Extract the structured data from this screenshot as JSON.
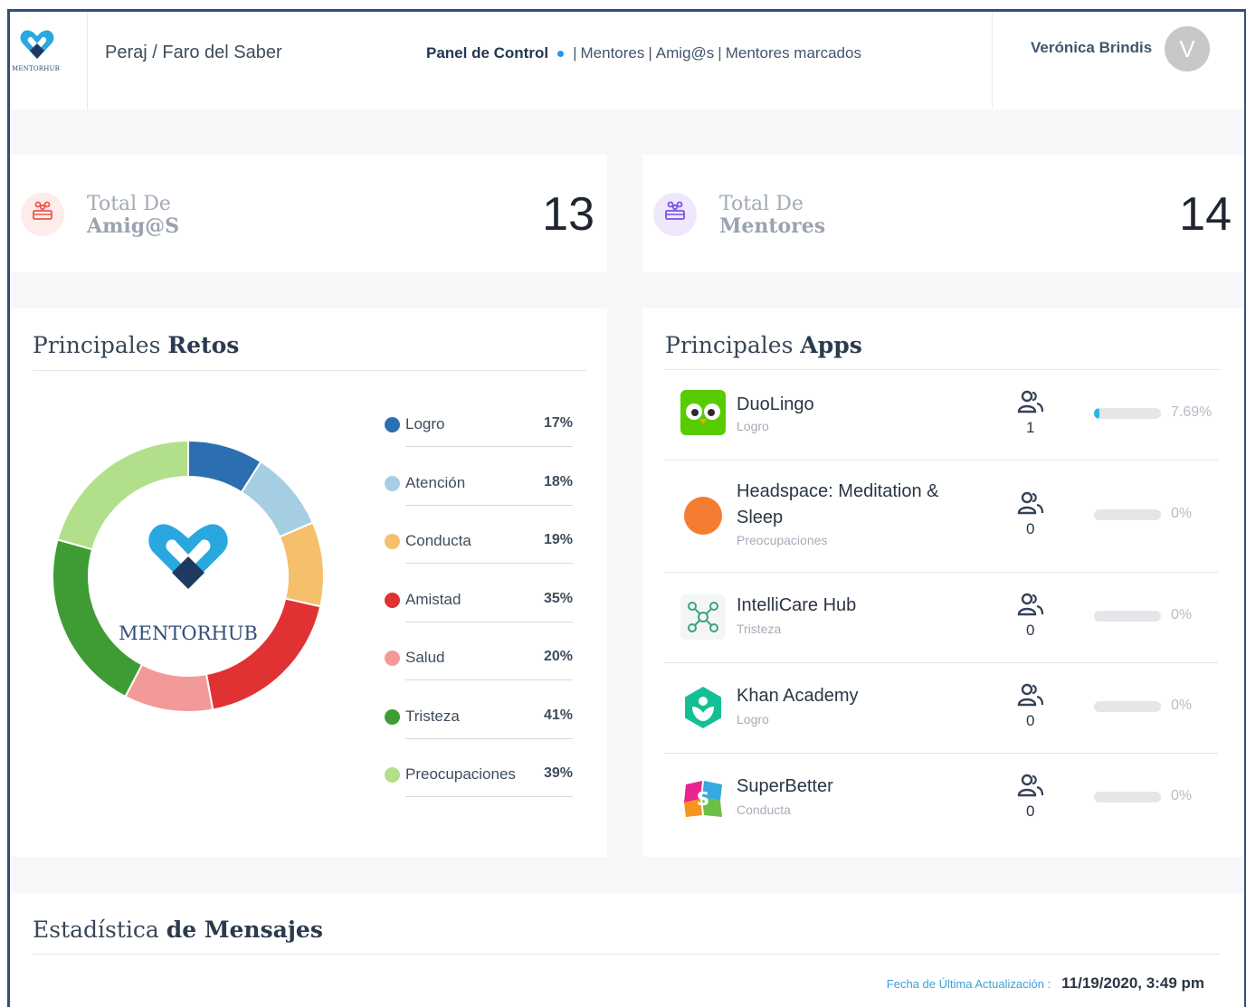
{
  "header": {
    "logo_text": "MENTORHUB",
    "org": "Peraj / Faro del Saber",
    "nav": {
      "active": "Panel de Control",
      "items": [
        "Mentores",
        "Amig@s",
        "Mentores marcados"
      ],
      "separator": "|"
    },
    "user_name": "Verónica Brindis",
    "avatar_initial": "V"
  },
  "stats": [
    {
      "label_line1": "Total De",
      "label_line2": "Amig@S",
      "value": "13",
      "icon": "group-icon",
      "color": "#e8574f"
    },
    {
      "label_line1": "Total De",
      "label_line2": "Mentores",
      "value": "14",
      "icon": "group-icon",
      "color": "#7b4fe0"
    }
  ],
  "retos": {
    "title_light": "Principales",
    "title_bold": "Retos",
    "center_logo": "MENTORHUB",
    "items": [
      {
        "name": "Logro",
        "pct": "17%",
        "value": 17,
        "color": "#2b6fb0"
      },
      {
        "name": "Atención",
        "pct": "18%",
        "value": 18,
        "color": "#a6cee3"
      },
      {
        "name": "Conducta",
        "pct": "19%",
        "value": 19,
        "color": "#f5bf6c"
      },
      {
        "name": "Amistad",
        "pct": "35%",
        "value": 35,
        "color": "#e03232"
      },
      {
        "name": "Salud",
        "pct": "20%",
        "value": 20,
        "color": "#f29a99"
      },
      {
        "name": "Tristeza",
        "pct": "41%",
        "value": 41,
        "color": "#3f9c35"
      },
      {
        "name": "Preocupaciones",
        "pct": "39%",
        "value": 39,
        "color": "#b2df8a"
      }
    ]
  },
  "apps": {
    "title_light": "Principales",
    "title_bold": "Apps",
    "items": [
      {
        "name": "DuoLingo",
        "category": "Logro",
        "count": "1",
        "progress": 7.69,
        "pct": "7.69%",
        "icon": "duolingo-icon"
      },
      {
        "name": "Headspace: Meditation & Sleep",
        "category": "Preocupaciones",
        "count": "0",
        "progress": 0,
        "pct": "0%",
        "icon": "headspace-icon"
      },
      {
        "name": "IntelliCare Hub",
        "category": "Tristeza",
        "count": "0",
        "progress": 0,
        "pct": "0%",
        "icon": "intellicare-icon"
      },
      {
        "name": "Khan Academy",
        "category": "Logro",
        "count": "0",
        "progress": 0,
        "pct": "0%",
        "icon": "khan-academy-icon"
      },
      {
        "name": "SuperBetter",
        "category": "Conducta",
        "count": "0",
        "progress": 0,
        "pct": "0%",
        "icon": "superbetter-icon"
      }
    ]
  },
  "mensajes": {
    "title_light": "Estadística",
    "title_bold": "de Mensajes",
    "update_label": "Fecha de Última Actualización :",
    "update_value": "11/19/2020, 3:49 pm"
  }
}
